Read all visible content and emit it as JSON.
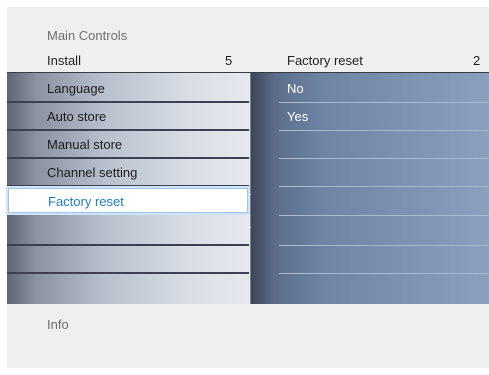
{
  "breadcrumb": "Main Controls",
  "header": {
    "left_title": "Install",
    "left_count": "5",
    "right_title": "Factory reset",
    "right_count": "2"
  },
  "menu": {
    "items": [
      {
        "label": "Language"
      },
      {
        "label": "Auto store"
      },
      {
        "label": "Manual store"
      },
      {
        "label": "Channel setting"
      },
      {
        "label": "Factory reset",
        "selected": true
      },
      {
        "label": ""
      },
      {
        "label": ""
      },
      {
        "label": ""
      }
    ]
  },
  "submenu": {
    "items": [
      {
        "label": "No"
      },
      {
        "label": "Yes"
      },
      {
        "label": ""
      },
      {
        "label": ""
      },
      {
        "label": ""
      },
      {
        "label": ""
      },
      {
        "label": ""
      },
      {
        "label": ""
      }
    ]
  },
  "footer": {
    "info_label": "Info"
  },
  "colors": {
    "selection_text": "#1d7fc2",
    "selection_border": "#9fc6e8",
    "submenu_base": "#7d94b4"
  }
}
